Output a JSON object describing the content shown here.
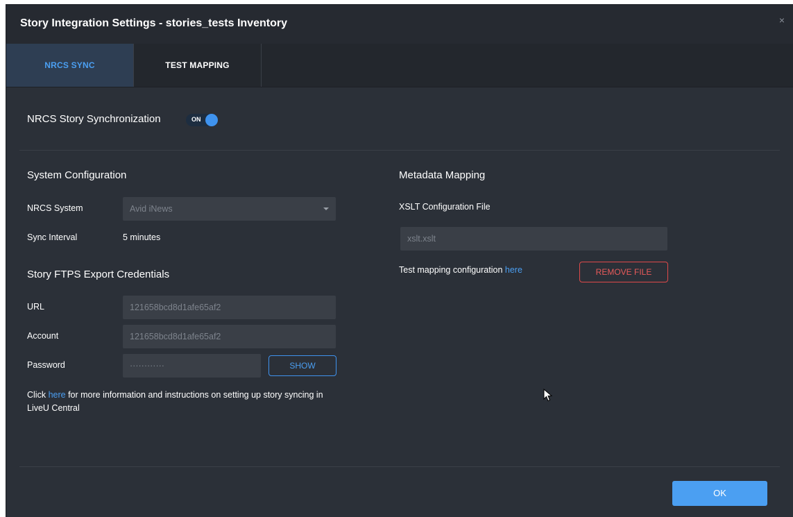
{
  "dialog": {
    "title": "Story Integration Settings - stories_tests Inventory",
    "close_glyph": "×"
  },
  "tabs": [
    {
      "label": "NRCS SYNC",
      "active": true
    },
    {
      "label": "TEST MAPPING",
      "active": false
    }
  ],
  "sync": {
    "label": "NRCS Story Synchronization",
    "toggle_label": "ON",
    "toggle_state": true
  },
  "system_config": {
    "title": "System Configuration",
    "nrcs_system_label": "NRCS System",
    "nrcs_system_value": "Avid iNews",
    "sync_interval_label": "Sync Interval",
    "sync_interval_value": "5 minutes"
  },
  "credentials": {
    "title": "Story FTPS Export Credentials",
    "url_label": "URL",
    "url_value": "121658bcd8d1afe65af2",
    "account_label": "Account",
    "account_value": "121658bcd8d1afe65af2",
    "password_label": "Password",
    "password_value": "············",
    "show_button": "SHOW"
  },
  "info": {
    "prefix": "Click ",
    "link": "here",
    "suffix": " for more information and instructions on setting up story syncing in LiveU Central"
  },
  "metadata": {
    "title": "Metadata Mapping",
    "xslt_label": "XSLT Configuration File",
    "xslt_value": "xslt.xslt",
    "test_prefix": "Test mapping configuration ",
    "test_link": "here",
    "remove_button": "REMOVE FILE"
  },
  "footer": {
    "ok_button": "OK"
  },
  "colors": {
    "accent": "#4b9ff2",
    "danger": "#e04a4a",
    "background": "#2b3038"
  }
}
